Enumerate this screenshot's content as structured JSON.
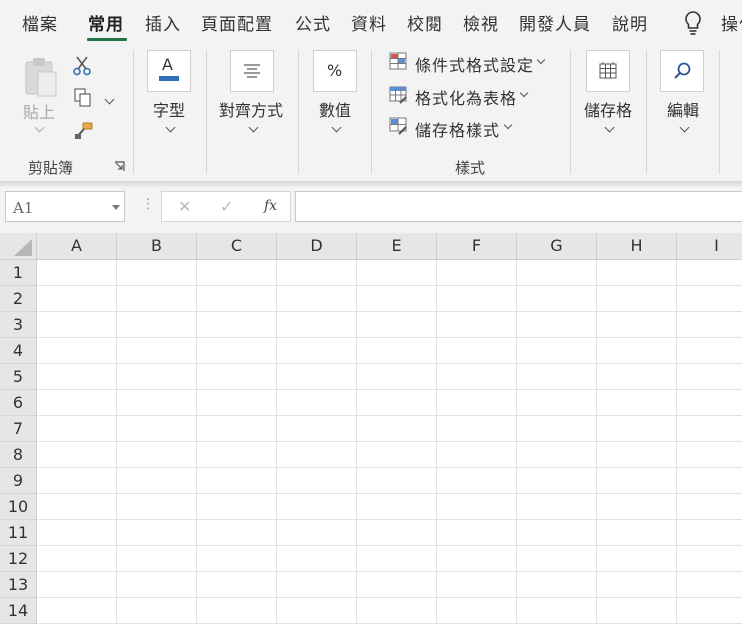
{
  "ribbon": {
    "tabs": [
      "檔案",
      "常用",
      "插入",
      "頁面配置",
      "公式",
      "資料",
      "校閱",
      "檢視",
      "開發人員",
      "說明"
    ],
    "active_tab": "常用",
    "tell_me_label": "操作",
    "clipboard": {
      "paste_label": "貼上",
      "group_label": "剪貼簿"
    },
    "font": {
      "label": "字型"
    },
    "alignment": {
      "label": "對齊方式"
    },
    "number": {
      "label": "數值"
    },
    "styles": {
      "conditional_formatting": "條件式格式設定",
      "format_as_table": "格式化為表格",
      "cell_styles": "儲存格樣式",
      "group_label": "樣式"
    },
    "cells": {
      "label": "儲存格"
    },
    "editing": {
      "label": "編輯"
    },
    "accent_color": "#217346"
  },
  "formula_bar": {
    "name_box": "A1",
    "fx_label": "fx",
    "cancel_symbol": "✕",
    "enter_symbol": "✓",
    "formula": ""
  },
  "sheet": {
    "columns": [
      "A",
      "B",
      "C",
      "D",
      "E",
      "F",
      "G",
      "H",
      "I"
    ],
    "rows": [
      "1",
      "2",
      "3",
      "4",
      "5",
      "6",
      "7",
      "8",
      "9",
      "10",
      "11",
      "12",
      "13",
      "14"
    ]
  }
}
